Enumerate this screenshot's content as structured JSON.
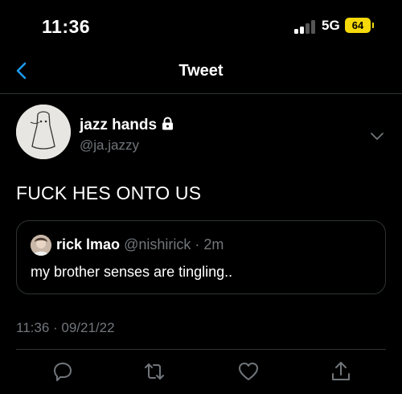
{
  "status_bar": {
    "time": "11:36",
    "network": "5G",
    "battery": "64"
  },
  "header": {
    "title": "Tweet"
  },
  "tweet": {
    "display_name": "jazz hands",
    "handle": "@ja.jazzy",
    "text": "FUCK HES ONTO US",
    "timestamp": "11:36 · 09/21/22"
  },
  "quote": {
    "display_name": "rick lmao",
    "handle": "@nishirick",
    "time": "· 2m",
    "text": "my brother senses are tingling.."
  },
  "colors": {
    "background": "#000000",
    "accent": "#1d9bf0",
    "secondary_text": "#71767b",
    "border": "#2f3336",
    "battery": "#f5d90a"
  },
  "icons": [
    "back-arrow-icon",
    "lock-icon",
    "chevron-down-icon",
    "reply-icon",
    "retweet-icon",
    "like-icon",
    "share-icon"
  ]
}
